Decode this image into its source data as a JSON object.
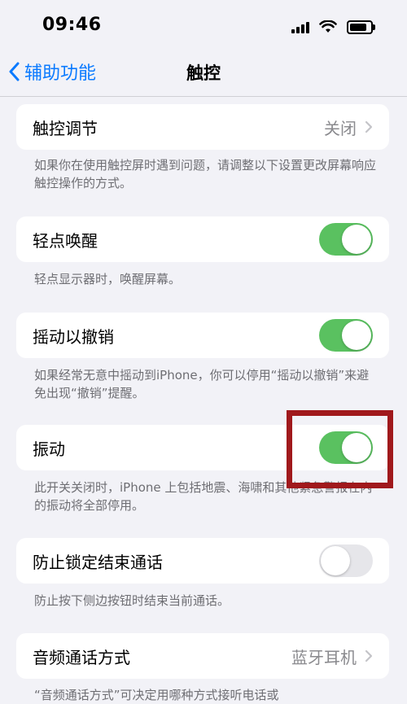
{
  "status": {
    "time": "09:46"
  },
  "nav": {
    "back_label": "辅助功能",
    "title": "触控"
  },
  "rows": {
    "touch_adapt": {
      "label": "触控调节",
      "value": "关闭",
      "note": "如果你在使用触控屏时遇到问题，请调整以下设置更改屏幕响应触控操作的方式。"
    },
    "tap_wake": {
      "label": "轻点唤醒",
      "toggle": "on",
      "note": "轻点显示器时，唤醒屏幕。"
    },
    "shake_undo": {
      "label": "摇动以撤销",
      "toggle": "on",
      "note": "如果经常无意中摇动到iPhone，你可以停用“摇动以撤销”来避免出现“撤销”提醒。"
    },
    "vibration": {
      "label": "振动",
      "toggle": "on",
      "note": "此开关关闭时，iPhone 上包括地震、海啸和其他紧急警报在内的振动将全部停用。"
    },
    "lock_end_call": {
      "label": "防止锁定结束通话",
      "toggle": "off",
      "note": "防止按下侧边按钮时结束当前通话。"
    },
    "call_audio": {
      "label": "音频通话方式",
      "value": "蓝牙耳机",
      "note": "“音频通话方式”可决定用哪种方式接听电话或"
    }
  },
  "colors": {
    "accent": "#0a7aff",
    "toggle_on": "#5ac160",
    "highlight": "#a0191c"
  }
}
